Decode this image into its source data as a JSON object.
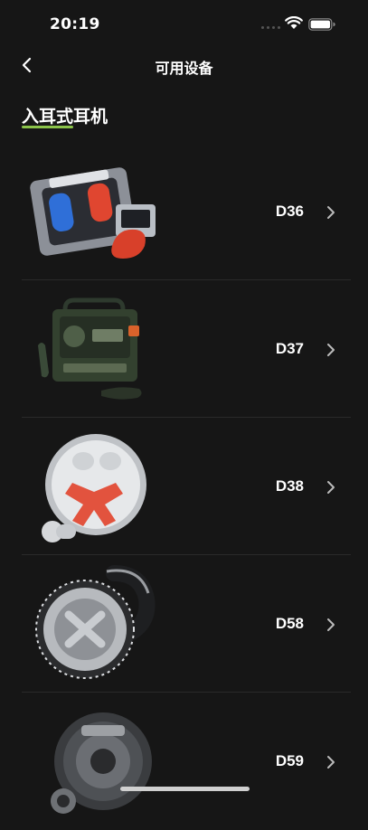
{
  "status": {
    "time": "20:19"
  },
  "nav": {
    "title": "可用设备"
  },
  "section": {
    "title": "入耳式耳机"
  },
  "devices": [
    {
      "name": "D36"
    },
    {
      "name": "D37"
    },
    {
      "name": "D38"
    },
    {
      "name": "D58"
    },
    {
      "name": "D59"
    }
  ],
  "colors": {
    "background": "#161616",
    "accent": "#8bc34a",
    "text": "#ffffff"
  },
  "icons": {
    "back": "chevron-left-icon",
    "row": "chevron-right-icon"
  }
}
